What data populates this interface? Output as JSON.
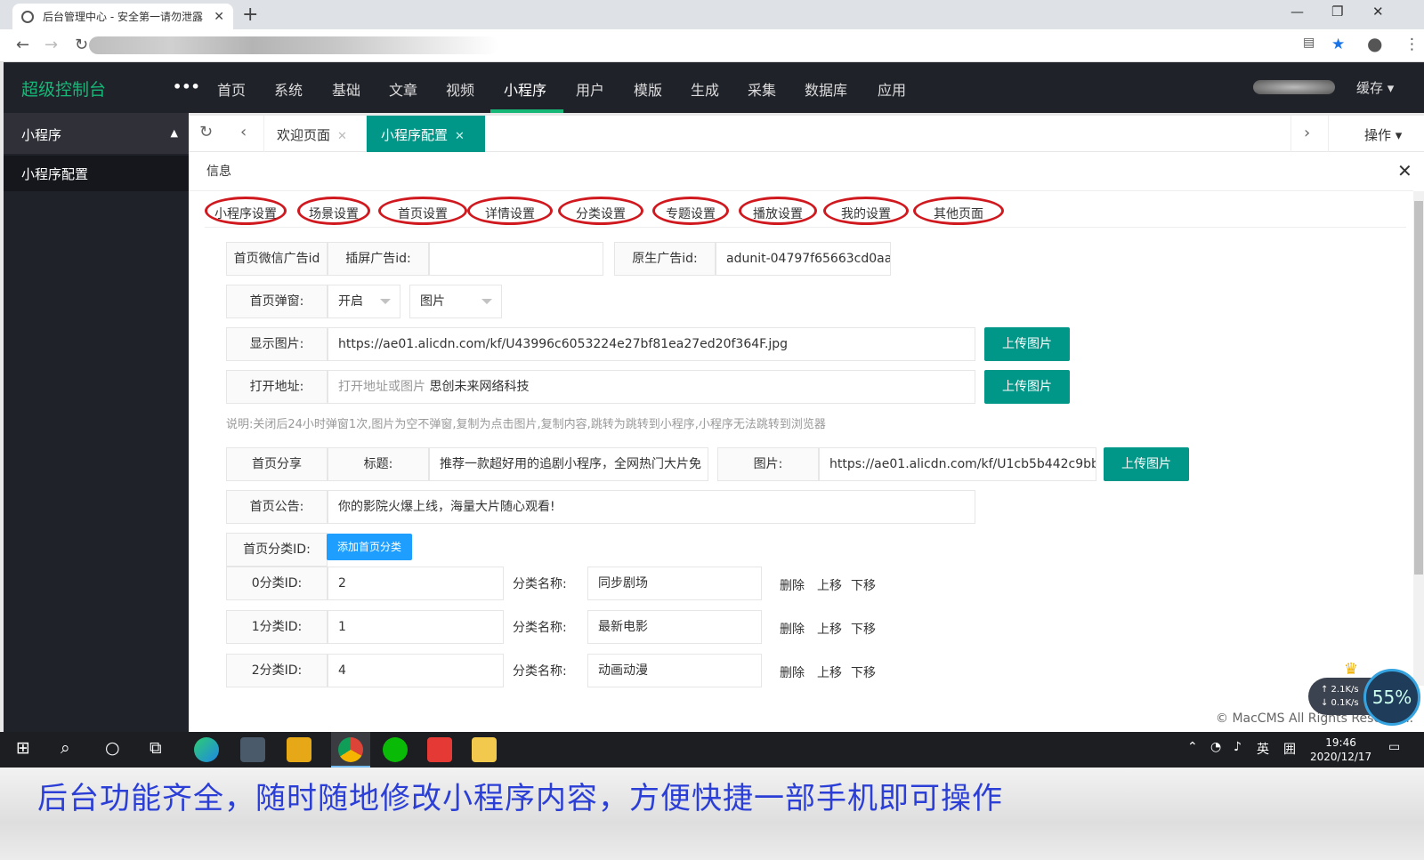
{
  "browser": {
    "tab_title": "后台管理中心 - 安全第一请勿泄露",
    "tab_close": "✕",
    "new_tab": "+",
    "minimize": "—",
    "restore": "❐",
    "close": "✕",
    "back": "←",
    "forward": "→",
    "reload": "↻"
  },
  "header": {
    "brand": "超级控制台",
    "more": "•••",
    "nav": [
      "首页",
      "系统",
      "基础",
      "文章",
      "视频",
      "小程序",
      "用户",
      "模版",
      "生成",
      "采集",
      "数据库",
      "应用"
    ],
    "active_index": 5,
    "cache": "缓存 ▾"
  },
  "sidebar": {
    "group": "小程序",
    "item": "小程序配置"
  },
  "content_tabs": {
    "welcome": "欢迎页面",
    "config": "小程序配置",
    "close": "✕",
    "ops": "操作 ▾"
  },
  "panel": {
    "title": "信息",
    "close": "✕"
  },
  "subtabs": [
    "小程序设置",
    "场景设置",
    "首页设置",
    "详情设置",
    "分类设置",
    "专题设置",
    "播放设置",
    "我的设置",
    "其他页面"
  ],
  "form": {
    "ad_wechat_label": "首页微信广告id",
    "ad_interstitial_label": "插屏广告id:",
    "ad_interstitial_value": "",
    "ad_native_label": "原生广告id:",
    "ad_native_value": "adunit-04797f65663cd0aa",
    "popup_label": "首页弹窗:",
    "popup_state": "开启",
    "popup_type": "图片",
    "image_label": "显示图片:",
    "image_value": "https://ae01.alicdn.com/kf/U43996c6053224e27bf81ea27ed20f364F.jpg",
    "upload_label": "上传图片",
    "open_label": "打开地址:",
    "open_placeholder": "打开地址或图片",
    "open_value": "思创未来网络科技",
    "hint": "说明:关闭后24小时弹窗1次,图片为空不弹窗,复制为点击图片,复制内容,跳转为跳转到小程序,小程序无法跳转到浏览器",
    "share_label": "首页分享",
    "share_title_label": "标题:",
    "share_title_value": "推荐一款超好用的追剧小程序，全网热门大片免",
    "share_image_label": "图片:",
    "share_image_value": "https://ae01.alicdn.com/kf/U1cb5b442c9bb",
    "notice_label": "首页公告:",
    "notice_value": "你的影院火爆上线，海量大片随心观看!",
    "category_label": "首页分类ID:",
    "add_category": "添加首页分类",
    "cat_name_label": "分类名称:",
    "delete": "删除",
    "up": "上移",
    "down": "下移",
    "categories": [
      {
        "label": "0分类ID:",
        "id": "2",
        "name": "同步剧场"
      },
      {
        "label": "1分类ID:",
        "id": "1",
        "name": "最新电影"
      },
      {
        "label": "2分类ID:",
        "id": "4",
        "name": "动画动漫"
      }
    ]
  },
  "footer": {
    "copyright": "© MacCMS All Rights Reserved."
  },
  "netmeter": {
    "up": "↑ 2.1K/s",
    "down": "↓ 0.1K/s",
    "percent": "55%"
  },
  "taskbar": {
    "start": "⊞",
    "search": "⌕",
    "cortana": "○",
    "taskview": "⧉",
    "ime": "英",
    "ime2": "囲",
    "time": "19:46",
    "date": "2020/12/17"
  },
  "caption": "后台功能齐全，随时随地修改小程序内容，方便快捷一部手机即可操作",
  "colors": {
    "brand": "#16b777",
    "primary": "#009688",
    "blue_button": "#1e9fff",
    "annotation_circle": "#d0191f",
    "caption": "#2b3fd6"
  }
}
